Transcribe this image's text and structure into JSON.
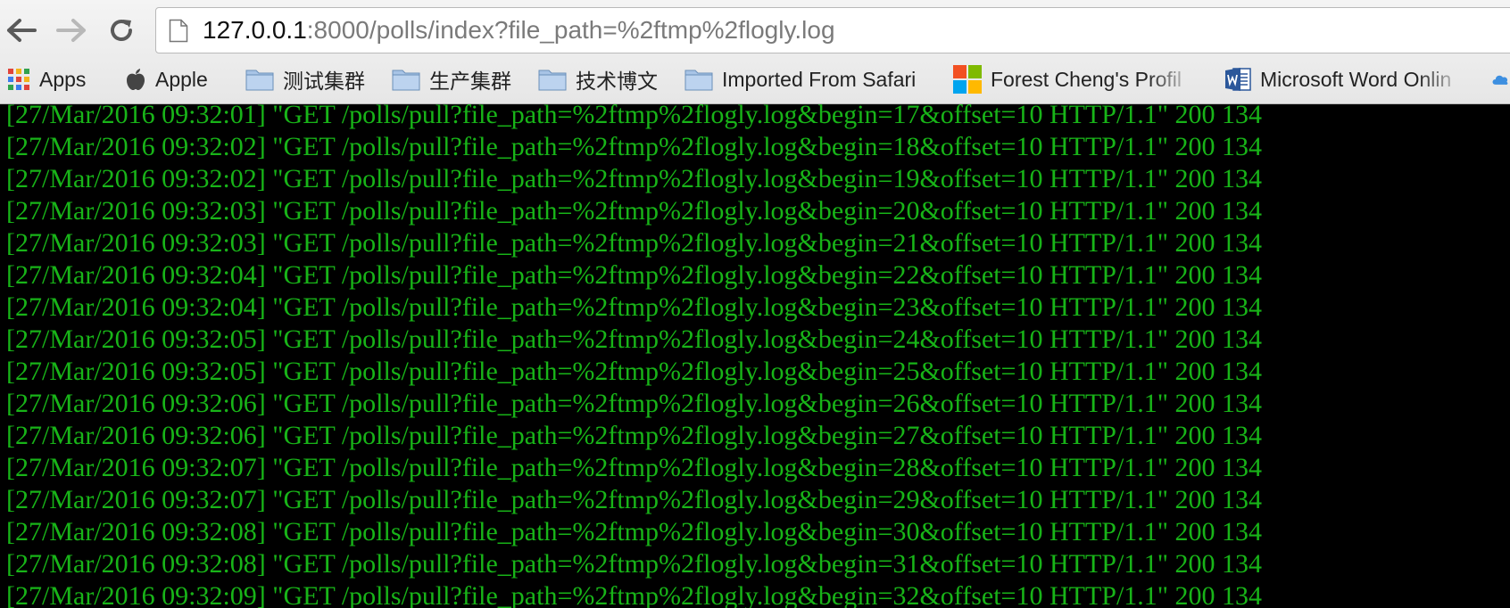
{
  "browser": {
    "url_host": "127.0.0.1",
    "url_rest": ":8000/polls/index?file_path=%2ftmp%2flogly.log"
  },
  "bookmarks": [
    {
      "label": "Apps",
      "icon": "apps-grid-icon"
    },
    {
      "label": "Apple",
      "icon": "apple-logo-icon"
    },
    {
      "label": "测试集群",
      "icon": "folder-icon"
    },
    {
      "label": "生产集群",
      "icon": "folder-icon"
    },
    {
      "label": "技术博文",
      "icon": "folder-icon"
    },
    {
      "label": "Imported From Safari",
      "icon": "folder-icon"
    },
    {
      "label": "Forest Cheng's Profil",
      "icon": "windows-logo-icon"
    },
    {
      "label": "Microsoft Word Onlin",
      "icon": "word-icon"
    }
  ],
  "log_lines": [
    "[27/Mar/2016 09:32:01] \"GET /polls/pull?file_path=%2ftmp%2flogly.log&begin=17&offset=10 HTTP/1.1\" 200 134",
    "[27/Mar/2016 09:32:02] \"GET /polls/pull?file_path=%2ftmp%2flogly.log&begin=18&offset=10 HTTP/1.1\" 200 134",
    "[27/Mar/2016 09:32:02] \"GET /polls/pull?file_path=%2ftmp%2flogly.log&begin=19&offset=10 HTTP/1.1\" 200 134",
    "[27/Mar/2016 09:32:03] \"GET /polls/pull?file_path=%2ftmp%2flogly.log&begin=20&offset=10 HTTP/1.1\" 200 134",
    "[27/Mar/2016 09:32:03] \"GET /polls/pull?file_path=%2ftmp%2flogly.log&begin=21&offset=10 HTTP/1.1\" 200 134",
    "[27/Mar/2016 09:32:04] \"GET /polls/pull?file_path=%2ftmp%2flogly.log&begin=22&offset=10 HTTP/1.1\" 200 134",
    "[27/Mar/2016 09:32:04] \"GET /polls/pull?file_path=%2ftmp%2flogly.log&begin=23&offset=10 HTTP/1.1\" 200 134",
    "[27/Mar/2016 09:32:05] \"GET /polls/pull?file_path=%2ftmp%2flogly.log&begin=24&offset=10 HTTP/1.1\" 200 134",
    "[27/Mar/2016 09:32:05] \"GET /polls/pull?file_path=%2ftmp%2flogly.log&begin=25&offset=10 HTTP/1.1\" 200 134",
    "[27/Mar/2016 09:32:06] \"GET /polls/pull?file_path=%2ftmp%2flogly.log&begin=26&offset=10 HTTP/1.1\" 200 134",
    "[27/Mar/2016 09:32:06] \"GET /polls/pull?file_path=%2ftmp%2flogly.log&begin=27&offset=10 HTTP/1.1\" 200 134",
    "[27/Mar/2016 09:32:07] \"GET /polls/pull?file_path=%2ftmp%2flogly.log&begin=28&offset=10 HTTP/1.1\" 200 134",
    "[27/Mar/2016 09:32:07] \"GET /polls/pull?file_path=%2ftmp%2flogly.log&begin=29&offset=10 HTTP/1.1\" 200 134",
    "[27/Mar/2016 09:32:08] \"GET /polls/pull?file_path=%2ftmp%2flogly.log&begin=30&offset=10 HTTP/1.1\" 200 134",
    "[27/Mar/2016 09:32:08] \"GET /polls/pull?file_path=%2ftmp%2flogly.log&begin=31&offset=10 HTTP/1.1\" 200 134",
    "[27/Mar/2016 09:32:09] \"GET /polls/pull?file_path=%2ftmp%2flogly.log&begin=32&offset=10 HTTP/1.1\" 200 134"
  ],
  "colors": {
    "log_text": "#18b418",
    "page_background": "#000000",
    "chrome_background": "#ececec"
  }
}
